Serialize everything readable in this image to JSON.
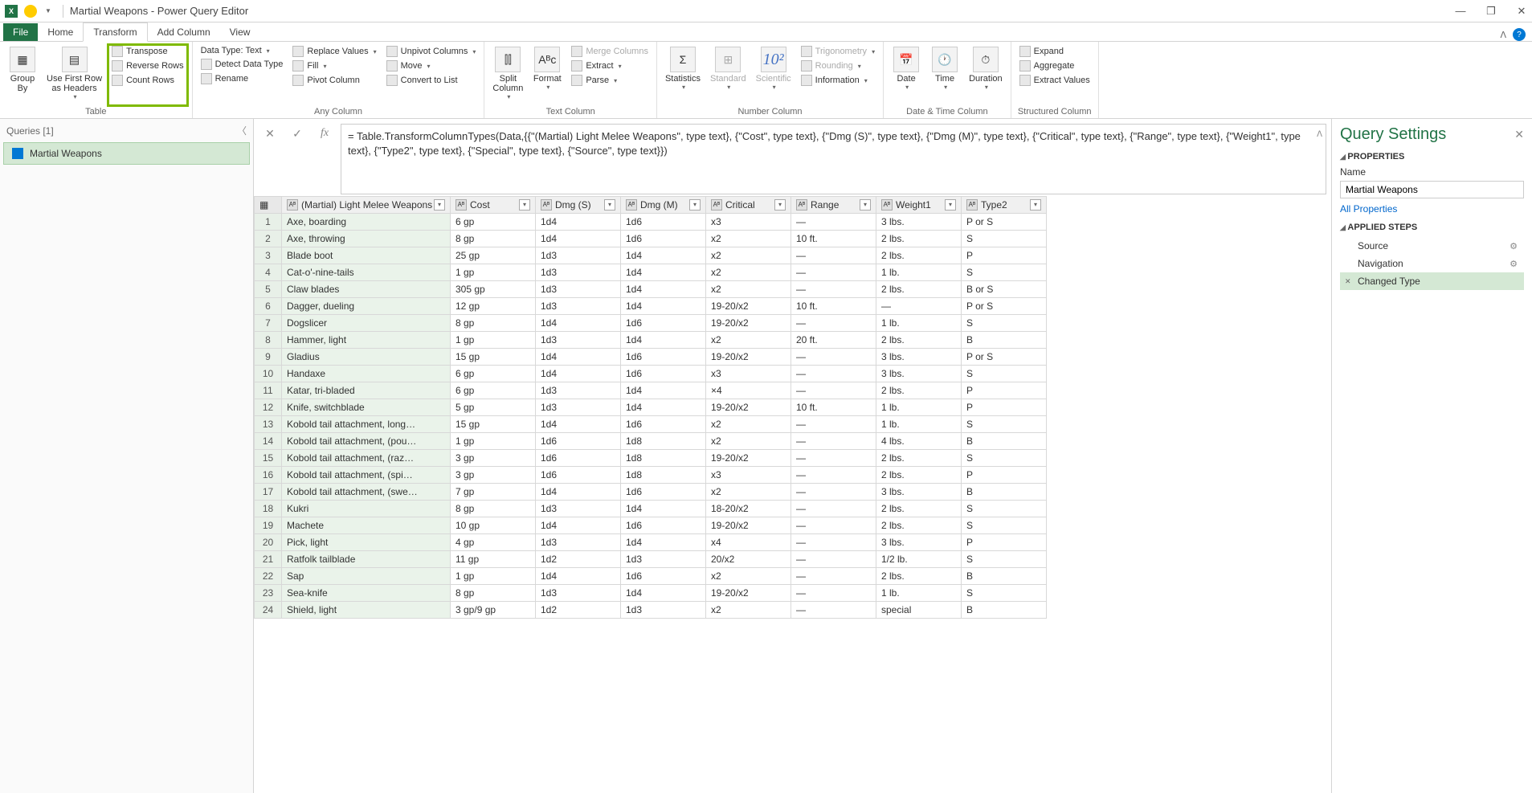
{
  "title": "Martial Weapons - Power Query Editor",
  "tabs": {
    "file": "File",
    "home": "Home",
    "transform": "Transform",
    "addcolumn": "Add Column",
    "view": "View"
  },
  "ribbon": {
    "table": {
      "label": "Table",
      "groupby": "Group\nBy",
      "firstrow": "Use First Row\nas Headers",
      "transpose": "Transpose",
      "reverse": "Reverse Rows",
      "count": "Count Rows"
    },
    "anycol": {
      "label": "Any Column",
      "datatype": "Data Type: Text",
      "detect": "Detect Data Type",
      "rename": "Rename",
      "replace": "Replace Values",
      "fill": "Fill",
      "pivot": "Pivot Column",
      "unpivot": "Unpivot Columns",
      "move": "Move",
      "convert": "Convert to List"
    },
    "textcol": {
      "label": "Text Column",
      "split": "Split\nColumn",
      "format": "Format",
      "merge": "Merge Columns",
      "extract": "Extract",
      "parse": "Parse"
    },
    "numcol": {
      "label": "Number Column",
      "stats": "Statistics",
      "standard": "Standard",
      "scientific": "Scientific",
      "trig": "Trigonometry",
      "round": "Rounding",
      "info": "Information"
    },
    "datecol": {
      "label": "Date & Time Column",
      "date": "Date",
      "time": "Time",
      "duration": "Duration"
    },
    "structcol": {
      "label": "Structured Column",
      "expand": "Expand",
      "aggregate": "Aggregate",
      "extractv": "Extract Values"
    }
  },
  "queries": {
    "header": "Queries [1]",
    "item": "Martial Weapons"
  },
  "formula": "= Table.TransformColumnTypes(Data,{{\"(Martial) Light Melee Weapons\", type text}, {\"Cost\", type text}, {\"Dmg (S)\", type text}, {\"Dmg (M)\", type text}, {\"Critical\", type text}, {\"Range\", type text}, {\"Weight1\", type text}, {\"Type2\", type text}, {\"Special\", type text}, {\"Source\", type text}})",
  "columns": [
    "(Martial) Light Melee Weapons",
    "Cost",
    "Dmg (S)",
    "Dmg (M)",
    "Critical",
    "Range",
    "Weight1",
    "Type2"
  ],
  "rows": [
    [
      "Axe, boarding",
      "6 gp",
      "1d4",
      "1d6",
      "x3",
      "—",
      "3 lbs.",
      "P or S"
    ],
    [
      "Axe, throwing",
      "8 gp",
      "1d4",
      "1d6",
      "x2",
      "10 ft.",
      "2 lbs.",
      "S"
    ],
    [
      "Blade boot",
      "25 gp",
      "1d3",
      "1d4",
      "x2",
      "—",
      "2 lbs.",
      "P"
    ],
    [
      "Cat-o'-nine-tails",
      "1 gp",
      "1d3",
      "1d4",
      "x2",
      "—",
      "1 lb.",
      "S"
    ],
    [
      "Claw blades",
      "305 gp",
      "1d3",
      "1d4",
      "x2",
      "—",
      "2 lbs.",
      "B or S"
    ],
    [
      "Dagger, dueling",
      "12 gp",
      "1d3",
      "1d4",
      "19-20/x2",
      "10 ft.",
      "—",
      "P or S"
    ],
    [
      "Dogslicer",
      "8 gp",
      "1d4",
      "1d6",
      "19-20/x2",
      "—",
      "1 lb.",
      "S"
    ],
    [
      "Hammer, light",
      "1 gp",
      "1d3",
      "1d4",
      "x2",
      "20 ft.",
      "2 lbs.",
      "B"
    ],
    [
      "Gladius",
      "15 gp",
      "1d4",
      "1d6",
      "19-20/x2",
      "—",
      "3 lbs.",
      "P or S"
    ],
    [
      "Handaxe",
      "6 gp",
      "1d4",
      "1d6",
      "x3",
      "—",
      "3 lbs.",
      "S"
    ],
    [
      "Katar, tri-bladed",
      "6 gp",
      "1d3",
      "1d4",
      "×4",
      "—",
      "2 lbs.",
      "P"
    ],
    [
      "Knife, switchblade",
      "5 gp",
      "1d3",
      "1d4",
      "19-20/x2",
      "10 ft.",
      "1 lb.",
      "P"
    ],
    [
      "Kobold tail attachment, long…",
      "15 gp",
      "1d4",
      "1d6",
      "x2",
      "—",
      "1 lb.",
      "S"
    ],
    [
      "Kobold tail attachment, (pou…",
      "1 gp",
      "1d6",
      "1d8",
      "x2",
      "—",
      "4 lbs.",
      "B"
    ],
    [
      "Kobold tail attachment, (raz…",
      "3 gp",
      "1d6",
      "1d8",
      "19-20/x2",
      "—",
      "2 lbs.",
      "S"
    ],
    [
      "Kobold tail attachment, (spi…",
      "3 gp",
      "1d6",
      "1d8",
      "x3",
      "—",
      "2 lbs.",
      "P"
    ],
    [
      "Kobold tail attachment, (swe…",
      "7 gp",
      "1d4",
      "1d6",
      "x2",
      "—",
      "3 lbs.",
      "B"
    ],
    [
      "Kukri",
      "8 gp",
      "1d3",
      "1d4",
      "18-20/x2",
      "—",
      "2 lbs.",
      "S"
    ],
    [
      "Machete",
      "10 gp",
      "1d4",
      "1d6",
      "19-20/x2",
      "—",
      "2 lbs.",
      "S"
    ],
    [
      "Pick, light",
      "4 gp",
      "1d3",
      "1d4",
      "x4",
      "—",
      "3 lbs.",
      "P"
    ],
    [
      "Ratfolk tailblade",
      "11 gp",
      "1d2",
      "1d3",
      "20/x2",
      "—",
      "1/2 lb.",
      "S"
    ],
    [
      "Sap",
      "1 gp",
      "1d4",
      "1d6",
      "x2",
      "—",
      "2 lbs.",
      "B"
    ],
    [
      "Sea-knife",
      "8 gp",
      "1d3",
      "1d4",
      "19-20/x2",
      "—",
      "1 lb.",
      "S"
    ],
    [
      "Shield, light",
      "3 gp/9 gp",
      "1d2",
      "1d3",
      "x2",
      "—",
      "special",
      "B"
    ]
  ],
  "settings": {
    "title": "Query Settings",
    "properties": "PROPERTIES",
    "name_label": "Name",
    "name_value": "Martial Weapons",
    "allprops": "All Properties",
    "applied": "APPLIED STEPS",
    "steps": [
      "Source",
      "Navigation",
      "Changed Type"
    ]
  }
}
